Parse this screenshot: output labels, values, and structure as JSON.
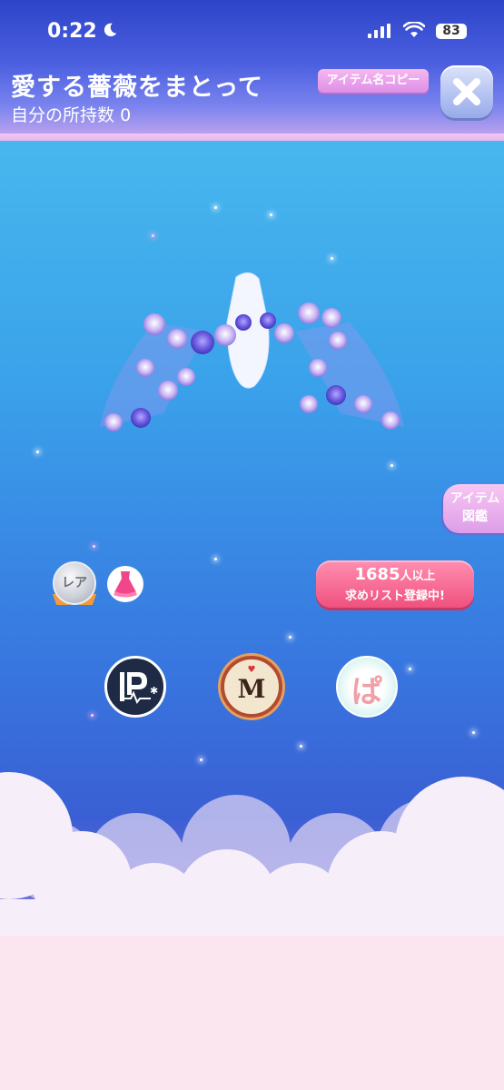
{
  "status_bar": {
    "time": "0:22",
    "battery": "83"
  },
  "header": {
    "title": "愛する薔薇をまとって",
    "owned_label": "自分の所持数",
    "owned_count": "0",
    "copy_button": "アイテム名コピー"
  },
  "side_tab": {
    "line1": "アイテム",
    "line2": "図鑑"
  },
  "rarity": {
    "label": "レア"
  },
  "wishlist": {
    "count": "1685",
    "count_suffix": "人以上",
    "text": "求めリスト登録中!"
  },
  "series": [
    {
      "icon": "p-series-icon"
    },
    {
      "icon": "m-series-icon",
      "letter": "M"
    },
    {
      "icon": "ba-series-icon",
      "letter": "ぱ"
    }
  ],
  "colors": {
    "accent_pink": "#f0517f",
    "header_blue": "#2e44c8",
    "tab_pink": "#dd9de8"
  }
}
